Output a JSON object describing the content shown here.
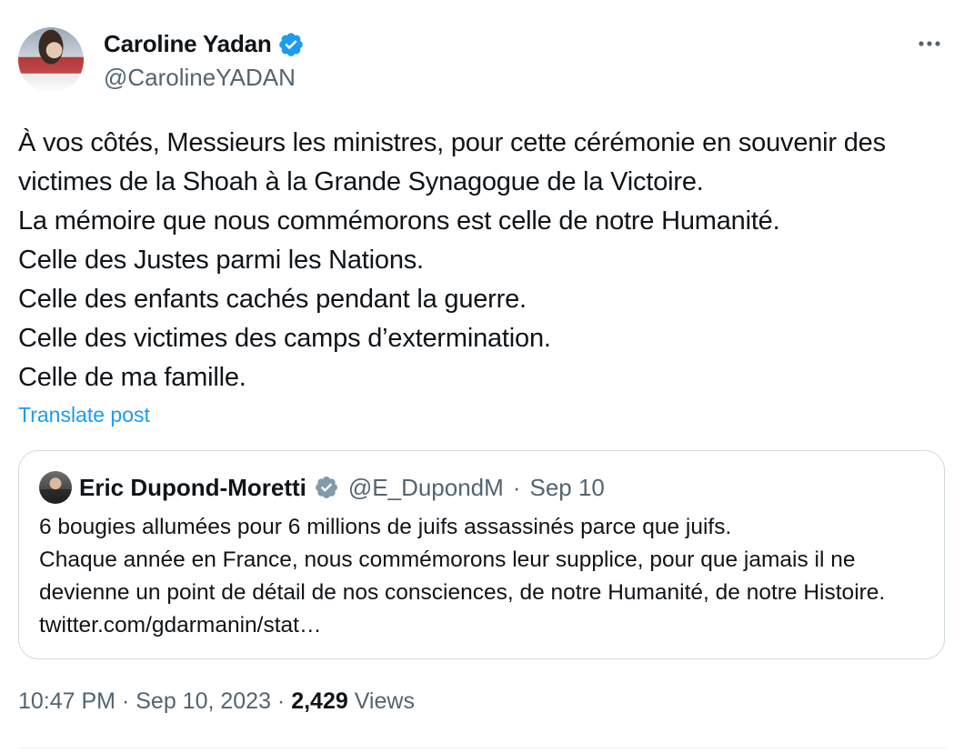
{
  "author": {
    "name": "Caroline Yadan",
    "handle": "@CarolineYADAN",
    "verified_icon": "verified-badge-icon"
  },
  "post": {
    "text": "À vos côtés, Messieurs les ministres, pour cette cérémonie en souvenir des victimes de la Shoah à la Grande Synagogue de la Victoire.\nLa mémoire que nous commémorons est celle de notre Humanité.\nCelle des Justes parmi les Nations.\nCelle des enfants cachés pendant la guerre.\nCelle des victimes des camps d’extermination.\nCelle de ma famille.",
    "translate_label": "Translate post"
  },
  "quote": {
    "author_name": "Eric Dupond-Moretti",
    "author_handle": "@E_DupondM",
    "separator": "·",
    "date": "Sep 10",
    "text": "6 bougies allumées pour 6 millions de juifs assassinés parce que juifs.\nChaque année en France, nous commémorons leur supplice, pour que jamais il ne devienne un point de détail de nos consciences, de notre Humanité, de notre Histoire. twitter.com/gdarmanin/stat…"
  },
  "meta": {
    "time": "10:47 PM",
    "separator": " · ",
    "date": "Sep 10, 2023",
    "views_count": "2,429",
    "views_label": " Views"
  },
  "colors": {
    "verified_blue": "#1d9bf0",
    "verified_gray": "#829aab",
    "muted_text": "#536471",
    "link": "#1d9bf0"
  }
}
